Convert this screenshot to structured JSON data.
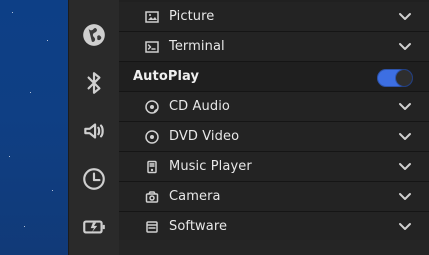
{
  "colors": {
    "wallpaper": "#0f3f84",
    "rail_bg": "#2a2a2a",
    "main_bg": "#202020",
    "row_bg": "#232323",
    "accent": "#3d6fe3",
    "icon": "#d0d0d0",
    "text": "#e8e8e8"
  },
  "rail": {
    "items": [
      {
        "name": "globe-icon"
      },
      {
        "name": "bluetooth-icon"
      },
      {
        "name": "speaker-icon"
      },
      {
        "name": "clock-icon"
      },
      {
        "name": "battery-icon"
      }
    ]
  },
  "list": {
    "rows": [
      {
        "label": "Picture",
        "icon": "picture-icon"
      },
      {
        "label": "Terminal",
        "icon": "terminal-icon"
      }
    ],
    "autoplay": {
      "label": "AutoPlay",
      "enabled": true
    },
    "media_rows": [
      {
        "label": "CD Audio",
        "icon": "cd-audio-icon"
      },
      {
        "label": "DVD Video",
        "icon": "dvd-video-icon"
      },
      {
        "label": "Music Player",
        "icon": "music-player-icon"
      },
      {
        "label": "Camera",
        "icon": "camera-icon"
      },
      {
        "label": "Software",
        "icon": "software-icon"
      }
    ]
  }
}
